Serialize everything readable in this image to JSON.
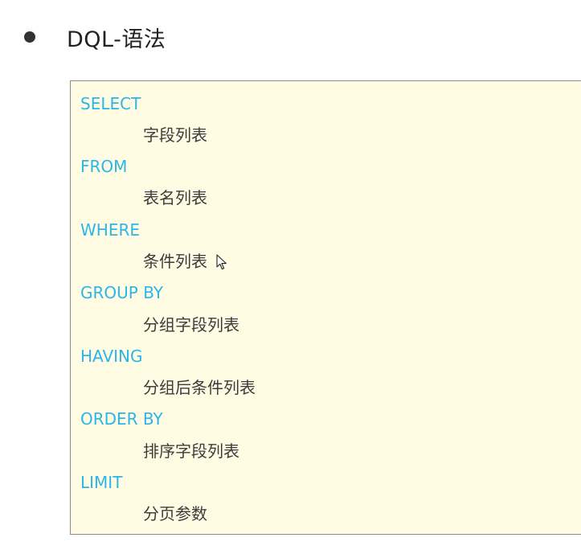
{
  "heading": {
    "text": "DQL-语法"
  },
  "syntax": [
    {
      "keyword": "SELECT",
      "argument": "字段列表"
    },
    {
      "keyword": "FROM",
      "argument": "表名列表"
    },
    {
      "keyword": "WHERE",
      "argument": "条件列表"
    },
    {
      "keyword": "GROUP  BY",
      "argument": "分组字段列表"
    },
    {
      "keyword": "HAVING",
      "argument": "分组后条件列表"
    },
    {
      "keyword": "ORDER BY",
      "argument": "排序字段列表"
    },
    {
      "keyword": "LIMIT",
      "argument": "分页参数"
    }
  ],
  "colors": {
    "keyword": "#2bb6ea",
    "argument": "#3c3c3c",
    "box_background": "#fffce3",
    "box_border": "#8c8c8c"
  },
  "icons": {
    "bullet": "bullet-dot-icon",
    "cursor": "mouse-pointer-icon"
  }
}
